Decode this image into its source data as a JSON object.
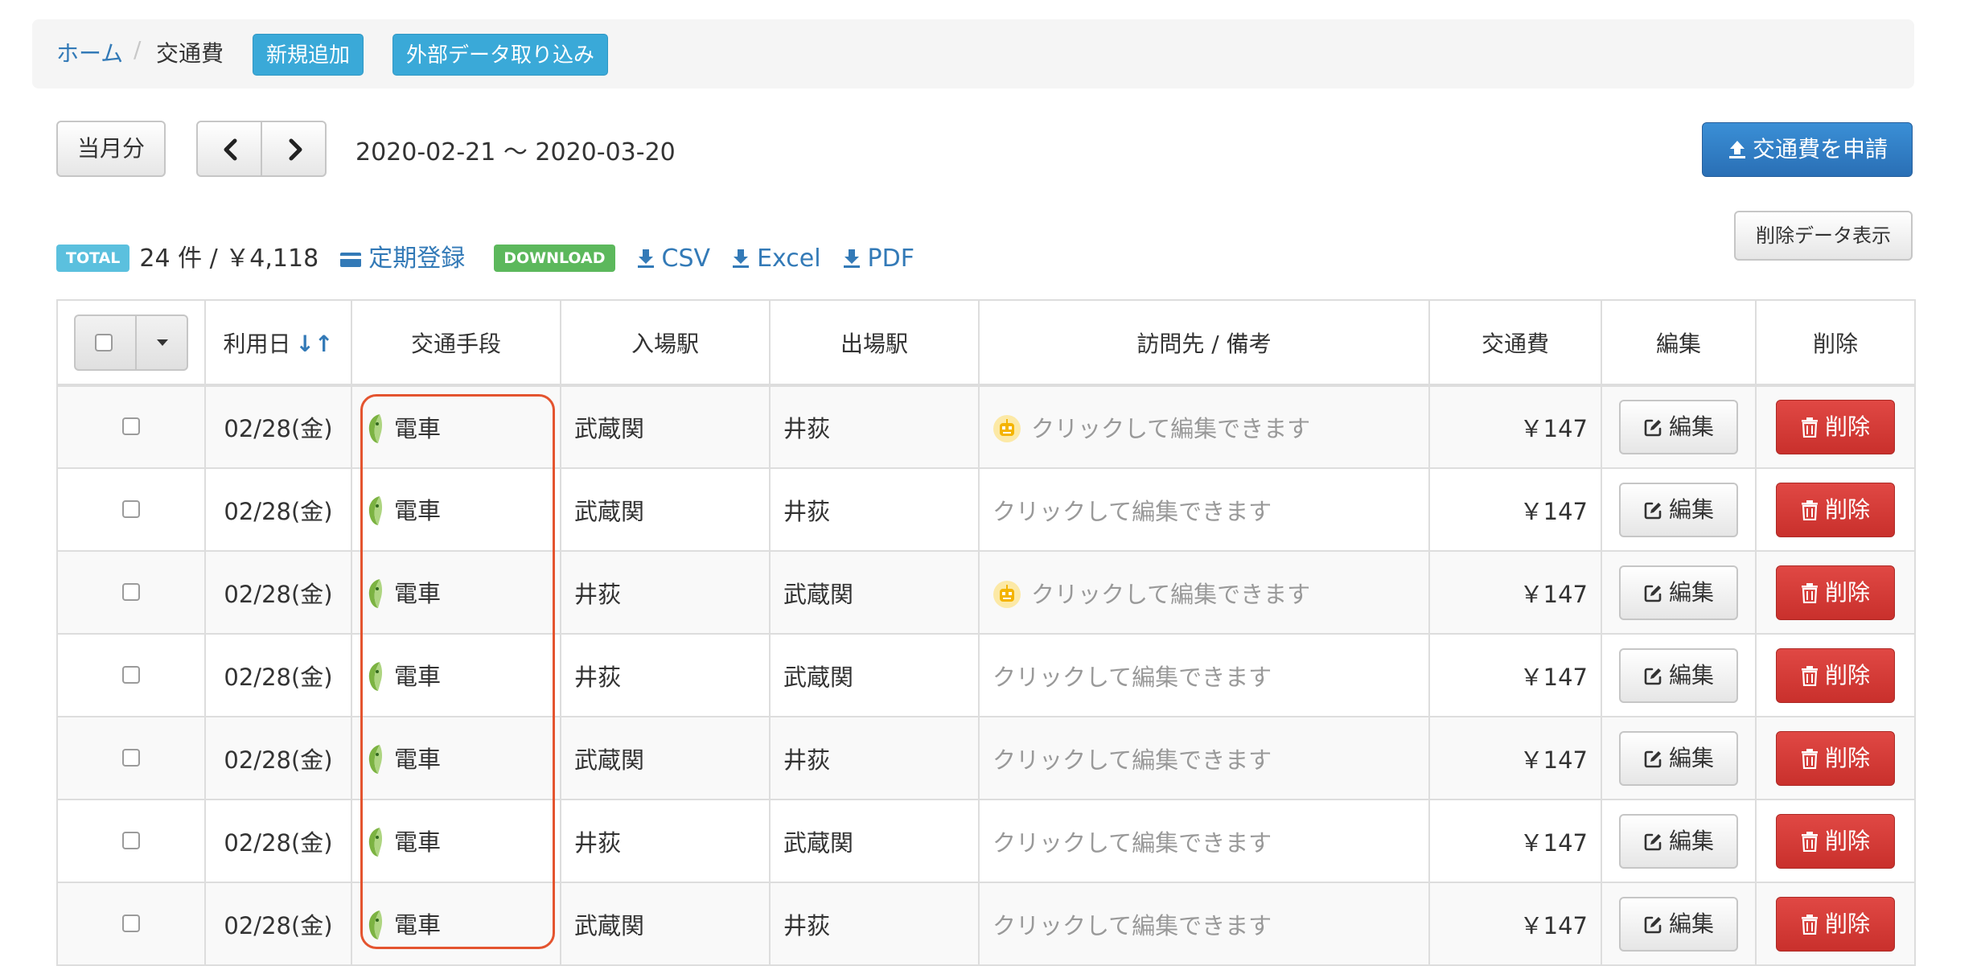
{
  "breadcrumb": {
    "home": "ホーム",
    "separator": "/",
    "current": "交通費"
  },
  "header_buttons": {
    "new": "新規追加",
    "import": "外部データ取り込み"
  },
  "toolbar": {
    "current_month": "当月分",
    "prev_icon": "chevron-left-icon",
    "next_icon": "chevron-right-icon",
    "date_range": "2020-02-21 〜 2020-03-20",
    "apply": "交通費を申請",
    "show_deleted": "削除データ表示"
  },
  "summary": {
    "total_badge": "TOTAL",
    "total_text": "24 件 / ￥4,118",
    "commuter_pass": "定期登録",
    "download_badge": "DOWNLOAD",
    "csv": "CSV",
    "excel": "Excel",
    "pdf": "PDF"
  },
  "table": {
    "headers": {
      "date": "利用日",
      "mode": "交通手段",
      "entry": "入場駅",
      "exit": "出場駅",
      "note": "訪問先 / 備考",
      "fare": "交通費",
      "edit": "編集",
      "delete": "削除"
    },
    "edit_label": "編集",
    "delete_label": "削除",
    "rows": [
      {
        "date": "02/28(金)",
        "mode": "電車",
        "entry": "武蔵関",
        "exit": "井荻",
        "note": "クリックして編集できます",
        "robot": true,
        "fare": "￥147"
      },
      {
        "date": "02/28(金)",
        "mode": "電車",
        "entry": "武蔵関",
        "exit": "井荻",
        "note": "クリックして編集できます",
        "robot": false,
        "fare": "￥147"
      },
      {
        "date": "02/28(金)",
        "mode": "電車",
        "entry": "井荻",
        "exit": "武蔵関",
        "note": "クリックして編集できます",
        "robot": true,
        "fare": "￥147"
      },
      {
        "date": "02/28(金)",
        "mode": "電車",
        "entry": "井荻",
        "exit": "武蔵関",
        "note": "クリックして編集できます",
        "robot": false,
        "fare": "￥147"
      },
      {
        "date": "02/28(金)",
        "mode": "電車",
        "entry": "武蔵関",
        "exit": "井荻",
        "note": "クリックして編集できます",
        "robot": false,
        "fare": "￥147"
      },
      {
        "date": "02/28(金)",
        "mode": "電車",
        "entry": "井荻",
        "exit": "武蔵関",
        "note": "クリックして編集できます",
        "robot": false,
        "fare": "￥147"
      },
      {
        "date": "02/28(金)",
        "mode": "電車",
        "entry": "武蔵関",
        "exit": "井荻",
        "note": "クリックして編集できます",
        "robot": false,
        "fare": "￥147"
      }
    ]
  },
  "colors": {
    "link": "#337ab7",
    "info_button": "#3aa9d8",
    "primary_button": "#2a6fb5",
    "danger_button": "#c9302c",
    "highlight": "#e4542f",
    "total_badge": "#5bc0de",
    "download_badge": "#5cb85c"
  }
}
